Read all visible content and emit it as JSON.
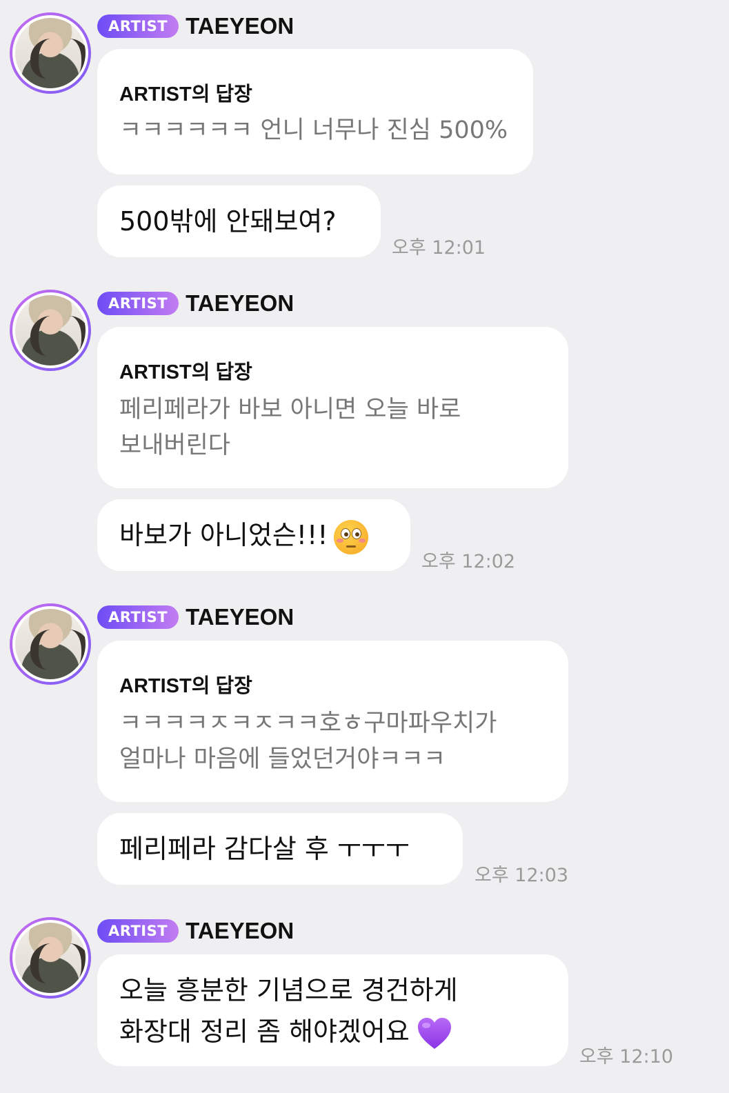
{
  "badge_label": "ARTIST",
  "artist_name": "TAEYEON",
  "messages": [
    {
      "reply_label": "ARTIST의 답장",
      "reply_lines": [
        "ㅋㅋㅋㅋㅋㅋ 언니 너무나 진심 500%"
      ],
      "text_lines": [
        "500밖에 안돼보여?"
      ],
      "time": "오후 12:01"
    },
    {
      "reply_label": "ARTIST의 답장",
      "reply_lines": [
        "페리페라가 바보 아니면 오늘 바로",
        "보내버린다"
      ],
      "text_lines": [
        "바보가 아니었슨!!!"
      ],
      "emoji": "flushed-face-icon",
      "time": "오후 12:02"
    },
    {
      "reply_label": "ARTIST의 답장",
      "reply_lines": [
        "ㅋㅋㅋㅋㅈㅋㅈㅋㅋ호ㅎ구마파우치가",
        "얼마나 마음에 들었던거야ㅋㅋㅋ"
      ],
      "text_lines": [
        "페리페라 감다살 후 ㅜㅜㅜ"
      ],
      "time": "오후 12:03"
    },
    {
      "text_lines": [
        "오늘 흥분한 기념으로 경건하게",
        "화장대 정리 좀 해야겠어요"
      ],
      "emoji": "purple-heart-icon",
      "time": "오후 12:10"
    }
  ],
  "colors": {
    "background": "#efeff1",
    "badge_start": "#6d4cf5",
    "badge_end": "#c27df2",
    "heart": "#9b45f0"
  }
}
